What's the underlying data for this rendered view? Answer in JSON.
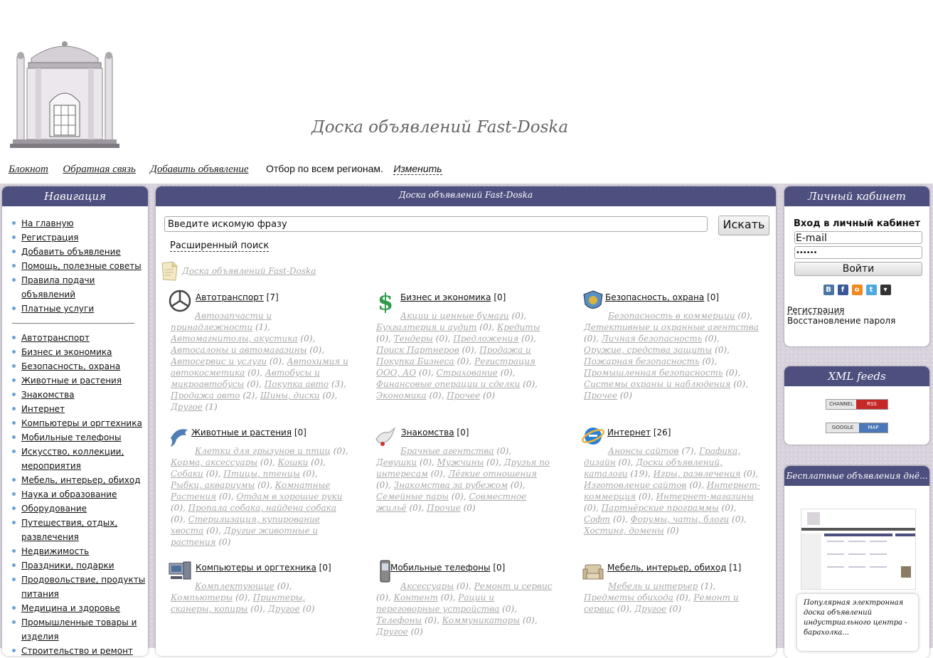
{
  "header": {
    "site_title": "Доска объявлений Fast-Doska",
    "nav": [
      {
        "label": "Блокнот"
      },
      {
        "label": "Обратная связь"
      },
      {
        "label": "Добавить объявление"
      }
    ],
    "region_text": "Отбор по всем регионам.",
    "region_change": "Изменить"
  },
  "left_panel": {
    "title": "Навигация",
    "main_links": [
      "На главную",
      "Регистрация",
      "Добавить объявление",
      "Помощь, полезные советы",
      "Правила подачи объявлений",
      "Платные услуги"
    ],
    "categories": [
      "Автотранспорт",
      "Бизнес и экономика",
      "Безопасность, охрана",
      "Животные и растения",
      "Знакомства",
      "Интернет",
      "Компьютеры и оргтехника",
      "Мобильные телефоны",
      "Искусство, коллекции, мероприятия",
      "Мебель, интерьер, обиход",
      "Наука и образование",
      "Оборудование",
      "Путешествия, отдых, развлечения",
      "Недвижимость",
      "Праздники, подарки",
      "Продовольствие, продукты питания",
      "Медицина и здоровье",
      "Промышленные товары и изделия",
      "Строительство и ремонт"
    ]
  },
  "center_panel": {
    "title": "Доска объявлений Fast-Doska",
    "search_placeholder": "Введите искомую фразу",
    "search_button": "Искать",
    "advanced_search": "Расширенный поиск",
    "breadcrumb": "Доска объявлений Fast-Doska",
    "categories": [
      {
        "name": "Автотранспорт",
        "count": "[7]",
        "icon": "mercedes-logo-icon",
        "subs": [
          [
            "Автозапчасти и принадлежности",
            "(1)"
          ],
          [
            "Автомагнитолы, акустика",
            "(0)"
          ],
          [
            "Автосалоны и автомагазины",
            "(0)"
          ],
          [
            "Автосервис и услуги",
            "(0)"
          ],
          [
            "Автохимия и автокосметика",
            "(0)"
          ],
          [
            "Автобусы и микроавтобусы",
            "(0)"
          ],
          [
            "Покупка авто",
            "(3)"
          ],
          [
            "Продажа авто",
            "(2)"
          ],
          [
            "Шины, диски",
            "(0)"
          ],
          [
            "Другое",
            "(1)"
          ]
        ]
      },
      {
        "name": "Бизнес и экономика",
        "count": "[0]",
        "icon": "dollar-sign-icon",
        "subs": [
          [
            "Акции и ценные бумаги",
            "(0)"
          ],
          [
            "Бухгалтерия и аудит",
            "(0)"
          ],
          [
            "Кредиты",
            "(0)"
          ],
          [
            "Тендеры",
            "(0)"
          ],
          [
            "Предложения",
            "(0)"
          ],
          [
            "Поиск Партнеров",
            "(0)"
          ],
          [
            "Продажа и Покупка Бизнеса",
            "(0)"
          ],
          [
            "Регистрация ООО, АО",
            "(0)"
          ],
          [
            "Страхование",
            "(0)"
          ],
          [
            "Финансовые операции и сделки",
            "(0)"
          ],
          [
            "Экономика",
            "(0)"
          ],
          [
            "Прочее",
            "(0)"
          ]
        ]
      },
      {
        "name": "Безопасность, охрана",
        "count": "[0]",
        "icon": "security-shield-icon",
        "subs": [
          [
            "Безопасность в коммерции",
            "(0)"
          ],
          [
            "Детективные и охранные агентства",
            "(0)"
          ],
          [
            "Личная безопасность",
            "(0)"
          ],
          [
            "Оружие, средства защиты",
            "(0)"
          ],
          [
            "Пожарная безопасность",
            "(0)"
          ],
          [
            "Промышленная безопасность",
            "(0)"
          ],
          [
            "Системы охраны и наблюдения",
            "(0)"
          ],
          [
            "Прочее",
            "(0)"
          ]
        ]
      },
      {
        "name": "Животные и растения",
        "count": "[0]",
        "icon": "dolphin-icon",
        "subs": [
          [
            "Клетки для грызунов и птиц",
            "(0)"
          ],
          [
            "Корма, аксессуары",
            "(0)"
          ],
          [
            "Кошки",
            "(0)"
          ],
          [
            "Собаки",
            "(0)"
          ],
          [
            "Птицы, птенцы",
            "(0)"
          ],
          [
            "Рыбки, аквариумы",
            "(0)"
          ],
          [
            "Комнатные Растения",
            "(0)"
          ],
          [
            "Отдам в хорошие руки",
            "(0)"
          ],
          [
            "Пропала собака, найдена собака",
            "(0)"
          ],
          [
            "Стерилизация, купирование хвоста",
            "(0)"
          ],
          [
            "Другие животные и растения",
            "(0)"
          ]
        ]
      },
      {
        "name": "Знакомства",
        "count": "[0]",
        "icon": "dove-icon",
        "subs": [
          [
            "Брачные агентства",
            "(0)"
          ],
          [
            "Девушки",
            "(0)"
          ],
          [
            "Мужчины",
            "(0)"
          ],
          [
            "Друзья по интересам",
            "(0)"
          ],
          [
            "Лёгкие отношения",
            "(0)"
          ],
          [
            "Знакомства за рубежом",
            "(0)"
          ],
          [
            "Семейные пары",
            "(0)"
          ],
          [
            "Совместное жильё",
            "(0)"
          ],
          [
            "Прочие",
            "(0)"
          ]
        ]
      },
      {
        "name": "Интернет",
        "count": "[26]",
        "icon": "internet-explorer-icon",
        "subs": [
          [
            "Анонсы сайтов",
            "(7)"
          ],
          [
            "Графика, дизайн",
            "(0)"
          ],
          [
            "Доски объявлений, каталоги",
            "(19)"
          ],
          [
            "Игры, развлечения",
            "(0)"
          ],
          [
            "Изготовление сайтов",
            "(0)"
          ],
          [
            "Интернет-коммерция",
            "(0)"
          ],
          [
            "Интернет-магазины",
            "(0)"
          ],
          [
            "Партнёрские программы",
            "(0)"
          ],
          [
            "Софт",
            "(0)"
          ],
          [
            "Форумы, чаты, блоги",
            "(0)"
          ],
          [
            "Хостинг, домены",
            "(0)"
          ]
        ]
      },
      {
        "name": "Компьютеры и оргтехника",
        "count": "[0]",
        "icon": "computer-icon",
        "subs": [
          [
            "Комплектующие",
            "(0)"
          ],
          [
            "Компьютеры",
            "(0)"
          ],
          [
            "Принтеры, сканеры, копиры",
            "(0)"
          ],
          [
            "Другое",
            "(0)"
          ]
        ]
      },
      {
        "name": "Мобильные телефоны",
        "count": "[0]",
        "icon": "mobile-phone-icon",
        "subs": [
          [
            "Аксессуары",
            "(0)"
          ],
          [
            "Ремонт и сервис",
            "(0)"
          ],
          [
            "Контент",
            "(0)"
          ],
          [
            "Рации и переговорные устройства",
            "(0)"
          ],
          [
            "Телефоны",
            "(0)"
          ],
          [
            "Коммуникаторы",
            "(0)"
          ],
          [
            "Другое",
            "(0)"
          ]
        ]
      },
      {
        "name": "Мебель, интерьер, обиход",
        "count": "[1]",
        "icon": "armchair-icon",
        "subs": [
          [
            "Мебель и интерьер",
            "(1)"
          ],
          [
            "Предметы обихода",
            "(0)"
          ],
          [
            "Ремонт и сервис",
            "(0)"
          ],
          [
            "Другое",
            "(0)"
          ]
        ]
      }
    ]
  },
  "right_panel": {
    "cabinet_title": "Личный кабинет",
    "login_title": "Вход в личный кабинет",
    "email_placeholder": "E-mail",
    "password_value": "••••••",
    "login_button": "Войти",
    "social_icons": [
      "vkontakte-icon",
      "facebook-icon",
      "odnoklassniki-icon",
      "twitter-icon",
      "dropdown-icon"
    ],
    "register_link": "Регистрация",
    "restore_link": "Восстановление пароля",
    "xml_title": "XML feeds",
    "rss_badge": {
      "left": "CHANNEL",
      "right": "RSS"
    },
    "map_badge": {
      "left": "GOOGLE",
      "right": "MAP"
    },
    "free_ads_title": "Бесплатные объявления днё...",
    "free_ads_caption": "Популярная электронная доска объявлений индустриального центра - барахолка..."
  },
  "colors": {
    "panel_header": "#4d4f7e",
    "bullet": "#6ba2d6",
    "sublink": "#aaaaaa",
    "rss_red": "#c62828",
    "map_blue": "#4a78b8"
  }
}
